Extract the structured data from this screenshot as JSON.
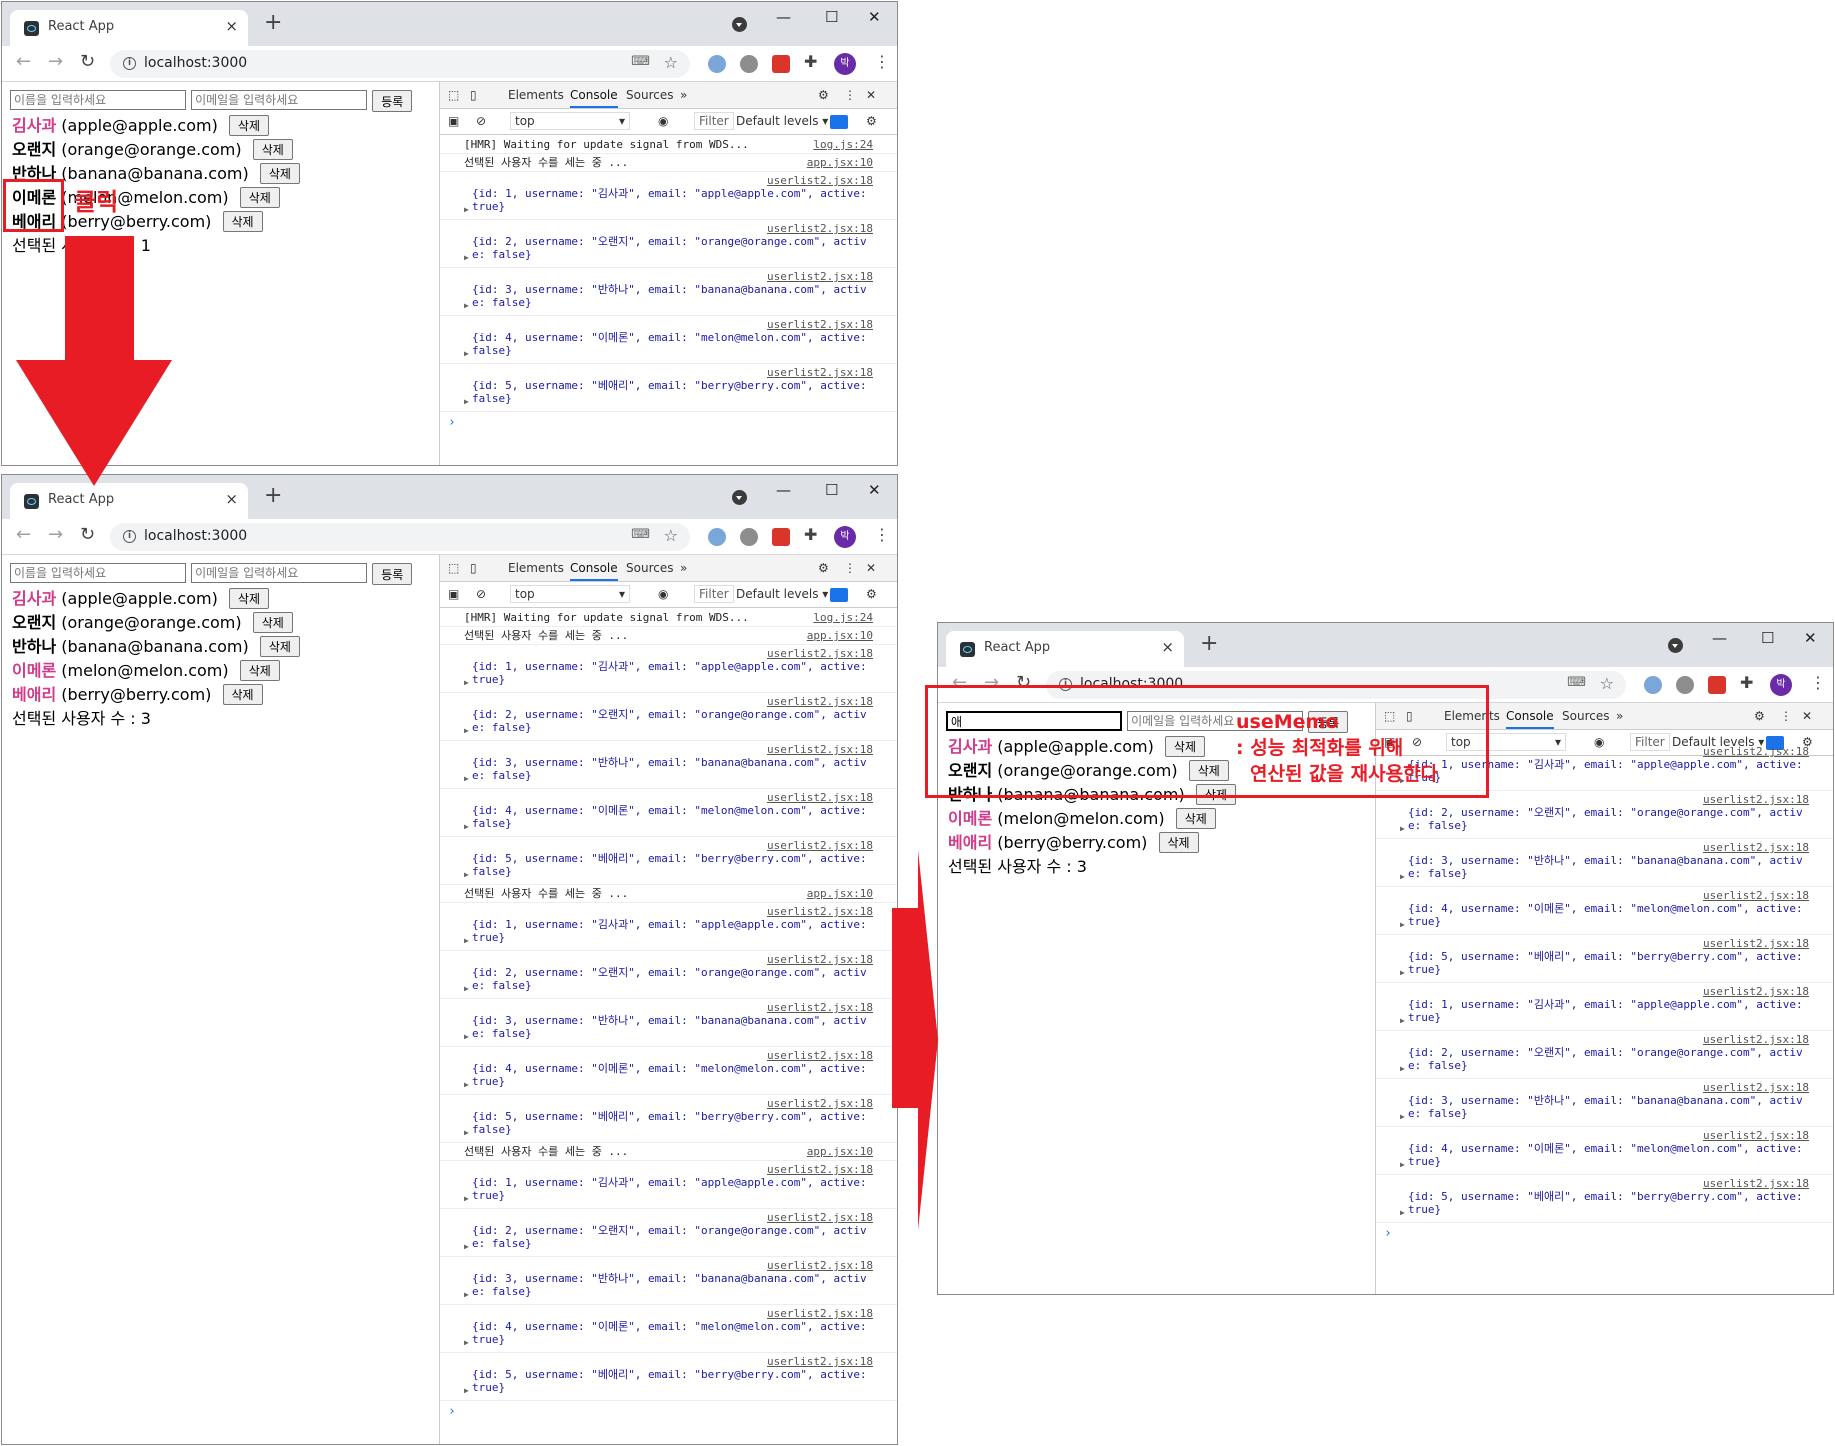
{
  "colors": {
    "accent": "#e81c24",
    "active_user": "#d13b8a",
    "react": "#61dafb",
    "avatar": "#6a2ba8"
  },
  "icons": [
    "back-arrow-icon",
    "forward-arrow-icon",
    "reload-icon",
    "info-icon",
    "translate-icon",
    "star-icon",
    "extension-icon",
    "avatar-icon",
    "kebab-icon",
    "inspect-icon",
    "device-icon",
    "settings-icon",
    "close-icon",
    "clear-console-icon",
    "eye-icon",
    "arrow-down-icon"
  ],
  "browser": {
    "tab_title": "React App",
    "tab_close": "×",
    "new_tab": "+",
    "url": "localhost:3000",
    "avatar": "박",
    "minimize": "—",
    "maximize": "☐",
    "close": "✕"
  },
  "form": {
    "name_placeholder": "이름을 입력하세요",
    "email_placeholder": "이메일을 입력하세요",
    "submit": "등록",
    "name_value_w3": "애"
  },
  "delete_label": "삭제",
  "users": [
    {
      "username": "김사과",
      "email": "(apple@apple.com)"
    },
    {
      "username": "오랜지",
      "email": "(orange@orange.com)"
    },
    {
      "username": "반하나",
      "email": "(banana@banana.com)"
    },
    {
      "username": "이메론",
      "email": "(melon@melon.com)"
    },
    {
      "username": "베애리",
      "email": "(berry@berry.com)"
    }
  ],
  "count_w1": "선택된 사용자 수 : 1",
  "count_w2": "선택된 사용자 수 : 3",
  "count_w3": "선택된 사용자 수 : 3",
  "devtools": {
    "elements": "Elements",
    "console": "Console",
    "sources": "Sources",
    "more": "»",
    "context": "top",
    "filter": "Filter",
    "levels": "Default levels ▾"
  },
  "log": {
    "hmr": "[HMR] Waiting for update signal from WDS...",
    "hmr_src": "log.js:24",
    "counting": "선택된 사용자 수를 세는 중 ...",
    "counting_src": "app.jsx:10",
    "obj_src": "userlist2.jsx:18",
    "objs_a": [
      "{id: 1, username: \"김사과\", email: \"apple@apple.com\", active: true}",
      "{id: 2, username: \"오랜지\", email: \"orange@orange.com\", active: false}",
      "{id: 3, username: \"반하나\", email: \"banana@banana.com\", active: false}",
      "{id: 4, username: \"이메론\", email: \"melon@melon.com\", active: false}",
      "{id: 5, username: \"베애리\", email: \"berry@berry.com\", active: false}"
    ],
    "objs_b": [
      "{id: 1, username: \"김사과\", email: \"apple@apple.com\", active: true}",
      "{id: 2, username: \"오랜지\", email: \"orange@orange.com\", active: false}",
      "{id: 3, username: \"반하나\", email: \"banana@banana.com\", active: false}",
      "{id: 4, username: \"이메론\", email: \"melon@melon.com\", active: true}",
      "{id: 5, username: \"베애리\", email: \"berry@berry.com\", active: false}"
    ],
    "objs_c": [
      "{id: 1, username: \"김사과\", email: \"apple@apple.com\", active: true}",
      "{id: 2, username: \"오랜지\", email: \"orange@orange.com\", active: false}",
      "{id: 3, username: \"반하나\", email: \"banana@banana.com\", active: false}",
      "{id: 4, username: \"이메론\", email: \"melon@melon.com\", active: true}",
      "{id: 5, username: \"베애리\", email: \"berry@berry.com\", active: true}"
    ],
    "prompt": "›"
  },
  "annotations": {
    "click": "클릭",
    "use_memo": "useMemo",
    "use_memo_line1": ": 성능 최적화를 위해",
    "use_memo_line2": "연산된 값을 재사용한다"
  }
}
